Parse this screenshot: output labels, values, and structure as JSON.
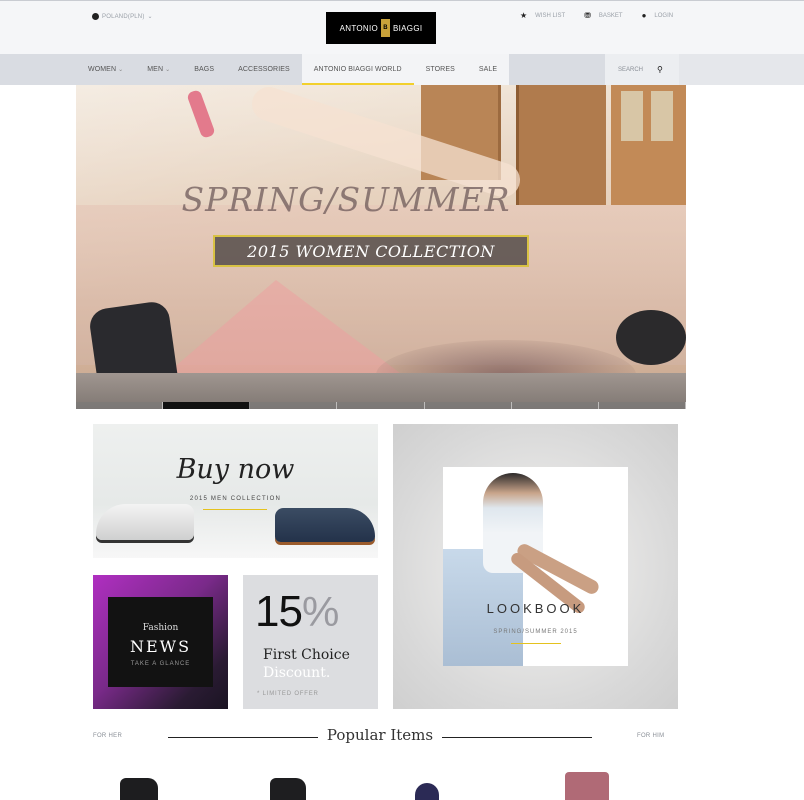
{
  "header": {
    "locale": "POLAND(PLN)",
    "locale_icon": "globe-icon",
    "logo_left": "ANTONIO",
    "logo_mark": "B",
    "logo_right": "BIAGGI",
    "links": [
      {
        "label": "WISH LIST",
        "icon": "star-icon"
      },
      {
        "label": "BASKET",
        "icon": "basket-icon"
      },
      {
        "label": "LOGIN",
        "icon": "user-icon"
      }
    ]
  },
  "nav": {
    "items": [
      "WOMEN",
      "MEN",
      "BAGS",
      "ACCESSORIES",
      "ANTONIO BIAGGI WORLD",
      "STORES",
      "SALE"
    ],
    "search_label": "SEARCH",
    "search_icon": "search-icon",
    "active_color": "#f2d02c"
  },
  "hero": {
    "title": "SPRING/SUMMER",
    "banner": "2015 WOMEN COLLECTION",
    "slide_count": 7,
    "active_slide": 2
  },
  "tiles": {
    "buy": {
      "heading": "Buy now",
      "sub": "2015 MEN COLLECTION"
    },
    "lookbook": {
      "heading": "LOOKBOOK",
      "sub": "SPRING/SUMMER 2015"
    },
    "news": {
      "kicker": "Fashion",
      "heading": "NEWS",
      "sub": "TAKE A GLANCE"
    },
    "offer": {
      "percent": "15",
      "percent_sign": "%",
      "line1": "First Choice",
      "line2": "Discount.",
      "note": "* LIMITED OFFER"
    }
  },
  "popular": {
    "left": "FOR HER",
    "title": "Popular Items",
    "right": "FOR HIM"
  },
  "colors": {
    "accent": "#f2d02c",
    "news_gradient": "#b02fc1"
  }
}
